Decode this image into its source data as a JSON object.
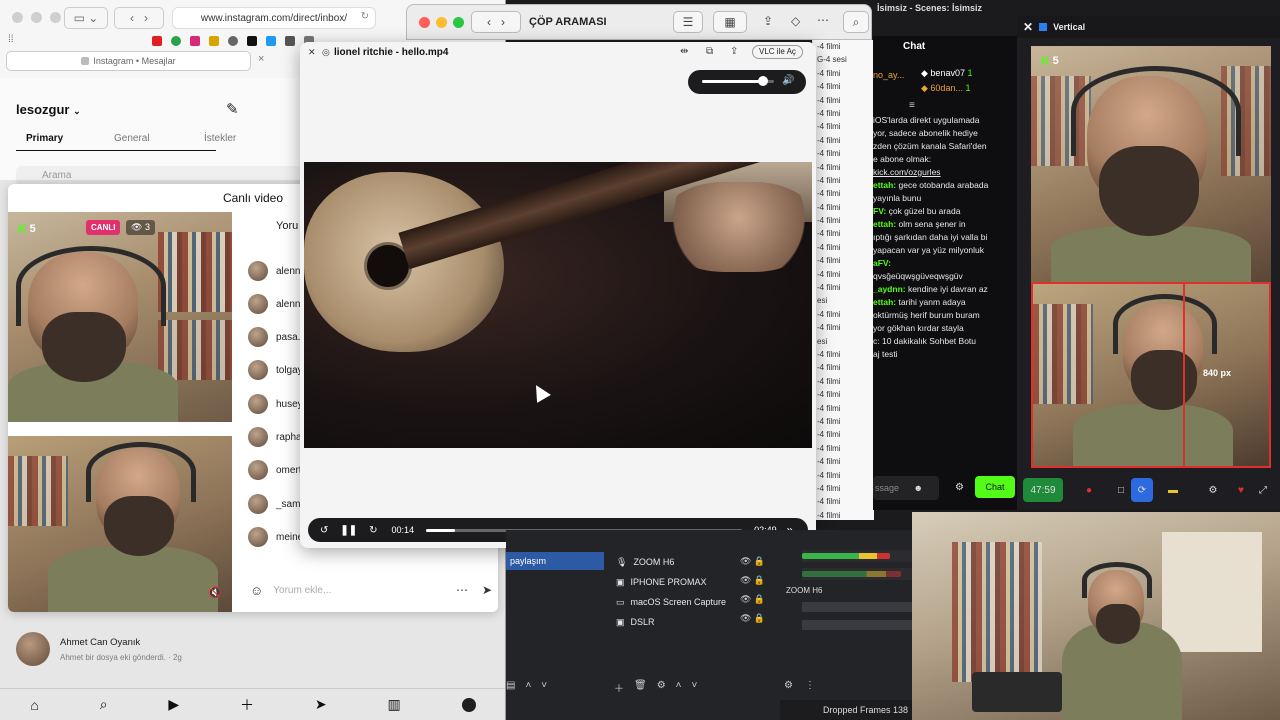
{
  "safari": {
    "url": "www.instagram.com/direct/inbox/",
    "tab_title": "Instagram • Mesajlar"
  },
  "instagram": {
    "username": "lesozgur",
    "tabs": [
      "Primary",
      "General",
      "İstekler"
    ],
    "search_placeholder": "Arama",
    "dm": {
      "name": "Ahmet Can Oyanık",
      "preview": "Ahmet bir dosya eki gönderdi. · 2g"
    }
  },
  "live_modal": {
    "title": "Canlı video",
    "canli": "CANLI",
    "viewers": "3",
    "kick_count": "5",
    "comments_header": "Yoru",
    "commenters": [
      "alenn",
      "alenn",
      "pasa.",
      "tolgay",
      "husey",
      "rapha",
      "omert",
      "_sam",
      "meine"
    ],
    "comment_placeholder": "Yorum ekle..."
  },
  "vlc": {
    "window_title": "ÇÖP ARAMASI",
    "player_title": "lionel ritchie - hello.mp4",
    "vlc_button": "VLC ile Aç",
    "time_current": "00:14",
    "time_total": "02:49",
    "progress": 0.09,
    "volume": 0.85,
    "playlist": [
      "G-4 sesi",
      "-4 filmi",
      "-4 filmi",
      "-4 filmi",
      "-4 filmi",
      "-4 filmi",
      "-4 filmi",
      "-4 filmi",
      "-4 filmi",
      "-4 filmi",
      "-4 filmi",
      "-4 filmi",
      "-4 filmi",
      "-4 filmi",
      "-4 filmi",
      "-4 filmi",
      "-4 filmi",
      "-4 filmi",
      "esi",
      "-4 filmi",
      "-4 filmi",
      "esi",
      "-4 filmi",
      "-4 filmi",
      "-4 filmi",
      "-4 filmi",
      "-4 filmi",
      "-4 filmi",
      "-4 filmi",
      "-4 filmi",
      "-4 filmi",
      "-4 filmi",
      "-4 filmi",
      "-4 filmi",
      "-4 filmi"
    ],
    "playlist_first": "-4 filmi"
  },
  "obs": {
    "scene_selected": "paylaşım",
    "sources": [
      "ZOOM H6",
      "IPHONE PROMAX",
      "macOS Screen Capture",
      "DSLR"
    ],
    "mixer_label": "ZOOM H6",
    "dropped_frames": "Dropped Frames 138"
  },
  "obs_title": "İsimsiz - Scenes: İsimsiz",
  "chat": {
    "title": "Chat",
    "top_user": "no_ay...",
    "users": [
      {
        "name": "benav07",
        "count": "1"
      },
      {
        "name": "60dan...",
        "count": "1"
      }
    ],
    "messages": [
      {
        "name": "",
        "text": "iOS'larda direkt uygulamada"
      },
      {
        "name": "",
        "text": "yor, sadece abonelik hediye"
      },
      {
        "name": "",
        "text": "zden çözüm kanala Safari'den"
      },
      {
        "name": "",
        "text": "e abone olmak:"
      },
      {
        "name": "",
        "text": "kick.com/ozgurles"
      },
      {
        "name": "ettah:",
        "text": " gece otobanda arabada"
      },
      {
        "name": "",
        "text": " yayınla bunu"
      },
      {
        "name": "FV:",
        "text": " çok güzel bu arada"
      },
      {
        "name": "ettah:",
        "text": " olm sena şener in"
      },
      {
        "name": "",
        "text": "ıptığı şarkıdan daha iyi valla bi"
      },
      {
        "name": "",
        "text": "yapacan var ya yüz milyonluk"
      },
      {
        "name": "aFV:",
        "text": ""
      },
      {
        "name": "",
        "text": "qvsğeüqwşgüveqwşgüv"
      },
      {
        "name": "_aydnn:",
        "text": " kendine iyi davran az"
      },
      {
        "name": "ettah:",
        "text": " tarihi yanm adaya"
      },
      {
        "name": "",
        "text": "oktürmüş herif burum buram"
      },
      {
        "name": "",
        "text": "yor gökhan kırdar stayla"
      },
      {
        "name": "",
        "text": "c: 10 dakikalık Sohbet Botu"
      },
      {
        "name": "",
        "text": "aj testi"
      }
    ],
    "message_placeholder": "ssage",
    "send_label": "Chat"
  },
  "vertical": {
    "title": "Vertical",
    "kick_count": "5",
    "size_label": "840 px",
    "timer": "47:59"
  },
  "colors": {
    "kick_green": "#53fc18",
    "ig_live": "#e1306c",
    "rec_red": "#e0302e"
  },
  "icons": [
    "sidebar-icon",
    "back-icon",
    "forward-icon",
    "reload-icon",
    "compose-icon",
    "home-icon",
    "search-icon",
    "reels-icon",
    "create-icon",
    "send-icon",
    "stats-icon",
    "pause-icon",
    "rewind-icon",
    "forward-15-icon",
    "volume-icon"
  ]
}
